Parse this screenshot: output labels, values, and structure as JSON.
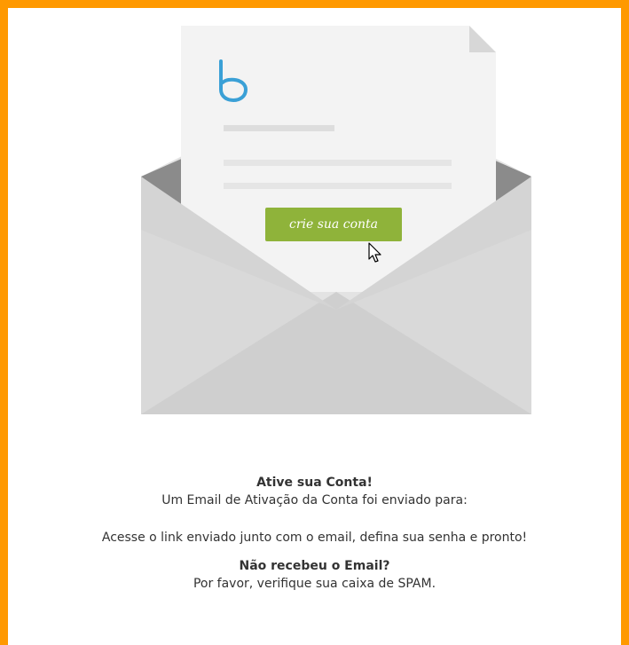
{
  "cta_button_label": "crie sua conta",
  "logo_letter": "b",
  "activate_title": "Ative sua Conta!",
  "activate_message": "Um Email de Ativação da Conta foi enviado para:",
  "instructions": "Acesse o link enviado junto com o email, defina sua senha e pronto!",
  "not_received_title": "Não recebeu o Email?",
  "spam_message": "Por favor, verifique sua caixa de SPAM.",
  "colors": {
    "border": "#ff9900",
    "button": "#8fb33a",
    "logo": "#3aa0d6"
  },
  "icons": {
    "illustration": "envelope-icon",
    "pointer": "mouse-pointer-icon"
  }
}
